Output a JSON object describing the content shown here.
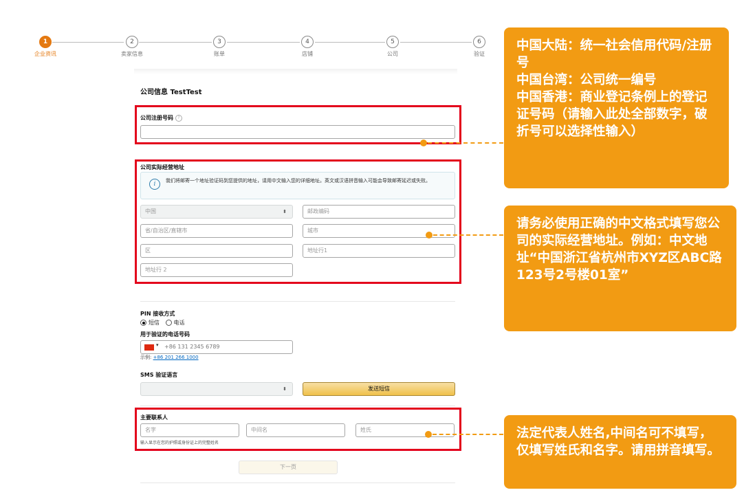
{
  "steps": [
    {
      "num": "1",
      "label": "企业资讯"
    },
    {
      "num": "2",
      "label": "卖家信息"
    },
    {
      "num": "3",
      "label": "账单"
    },
    {
      "num": "4",
      "label": "店铺"
    },
    {
      "num": "5",
      "label": "公司"
    },
    {
      "num": "6",
      "label": "验证"
    }
  ],
  "form": {
    "title": "公司信息 TestTest",
    "registration": {
      "label": "公司注册号码",
      "help_icon": "?",
      "value": ""
    },
    "address": {
      "label": "公司实际经营地址",
      "info_icon": "i",
      "info_text": "我们将邮寄一个地址验证码到您提供的地址，请用中文输入您的详细地址。英文或汉语拼音输入可能会导致邮寄延迟或失败。",
      "country": "中国",
      "postal_placeholder": "邮政编码",
      "province_placeholder": "省/自治区/直辖市",
      "city_placeholder": "城市",
      "district_placeholder": "区",
      "line1_placeholder": "地址行1",
      "line2_placeholder": "地址行 2"
    },
    "pin": {
      "label": "PIN 接收方式",
      "option_sms": "短信",
      "option_phone": "电话",
      "selected": "短信"
    },
    "phone": {
      "label": "用于验证的电话号码",
      "value": "+86 131 2345 6789",
      "example_prefix": "示例:",
      "example": "+86 201 266 1000"
    },
    "sms_language": {
      "label": "SMS 验证语言",
      "value": "",
      "send_button": "发送短信"
    },
    "contact": {
      "label": "主要联系人",
      "first_placeholder": "名字",
      "middle_placeholder": "中间名",
      "last_placeholder": "姓氏",
      "hint": "输入显示在您的护照或身份证上的完整姓名"
    },
    "next_button": "下一页"
  },
  "annotations": {
    "registration_note": "中国大陆：统一社会信用代码/注册号\n中国台湾：公司统一编号\n中国香港：商业登记条例上的登记证号码（请输入此处全部数字，破折号可以选择性输入）",
    "address_note": "请务必使用正确的中文格式填写您公司的实际经营地址。例如：中文地址“中国浙江省杭州市XYZ区ABC路123号2号楼01室”",
    "contact_note": "法定代表人姓名,中间名可不填写，仅填写姓氏和名字。请用拼音填写。"
  },
  "colors": {
    "accent": "#e47911",
    "highlight": "#e3001b",
    "callout": "#f29b13"
  }
}
